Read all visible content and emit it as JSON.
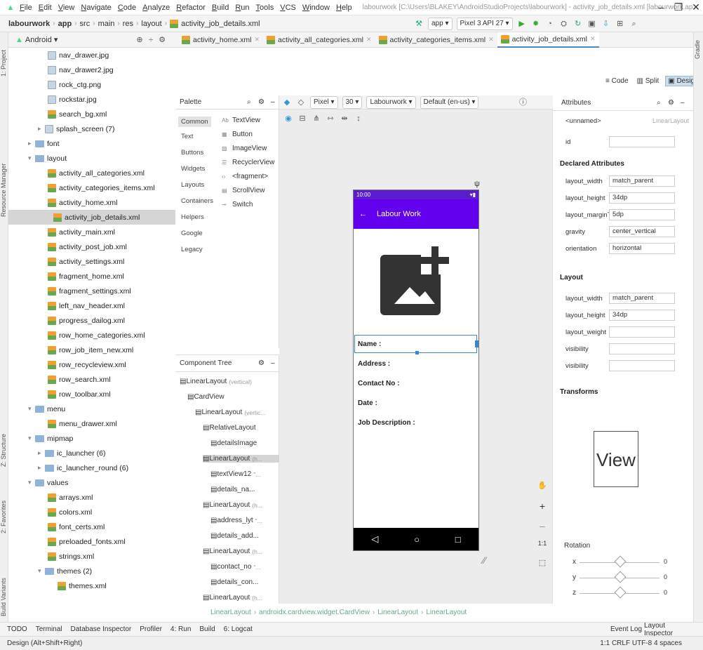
{
  "menu": [
    "File",
    "Edit",
    "View",
    "Navigate",
    "Code",
    "Analyze",
    "Refactor",
    "Build",
    "Run",
    "Tools",
    "VCS",
    "Window",
    "Help"
  ],
  "window_title": "labourwork [C:\\Users\\BLAKEY\\AndroidStudioProjects\\labourwork] - activity_job_details.xml [labourwork.app] - Android Studio",
  "nav": {
    "crumbs": [
      "labourwork",
      "app",
      "src",
      "main",
      "res",
      "layout",
      "activity_job_details.xml"
    ],
    "run_config": "app",
    "device": "Pixel 3 API 27"
  },
  "project_view": "Android",
  "tree": [
    {
      "label": "nav_drawer.jpg",
      "type": "img",
      "indent": 4
    },
    {
      "label": "nav_drawer2.jpg",
      "type": "img",
      "indent": 4
    },
    {
      "label": "rock_ctg.png",
      "type": "img",
      "indent": 4
    },
    {
      "label": "rockstar.jpg",
      "type": "img",
      "indent": 4
    },
    {
      "label": "search_bg.xml",
      "type": "xml",
      "indent": 4
    },
    {
      "label": "splash_screen (7)",
      "type": "img",
      "indent": 3,
      "arrow": "▸"
    },
    {
      "label": "font",
      "type": "fld",
      "indent": 2,
      "arrow": "▸"
    },
    {
      "label": "layout",
      "type": "fld",
      "indent": 2,
      "arrow": "▾"
    },
    {
      "label": "activity_all_categories.xml",
      "type": "xml",
      "indent": 4
    },
    {
      "label": "activity_categories_items.xml",
      "type": "xml",
      "indent": 4
    },
    {
      "label": "activity_home.xml",
      "type": "xml",
      "indent": 4
    },
    {
      "label": "activity_job_details.xml",
      "type": "xml",
      "indent": 4,
      "selected": true
    },
    {
      "label": "activity_main.xml",
      "type": "xml",
      "indent": 4
    },
    {
      "label": "activity_post_job.xml",
      "type": "xml",
      "indent": 4
    },
    {
      "label": "activity_settings.xml",
      "type": "xml",
      "indent": 4
    },
    {
      "label": "fragment_home.xml",
      "type": "xml",
      "indent": 4
    },
    {
      "label": "fragment_settings.xml",
      "type": "xml",
      "indent": 4
    },
    {
      "label": "left_nav_header.xml",
      "type": "xml",
      "indent": 4
    },
    {
      "label": "progress_dailog.xml",
      "type": "xml",
      "indent": 4
    },
    {
      "label": "row_home_categories.xml",
      "type": "xml",
      "indent": 4
    },
    {
      "label": "row_job_item_new.xml",
      "type": "xml",
      "indent": 4
    },
    {
      "label": "row_recycleview.xml",
      "type": "xml",
      "indent": 4
    },
    {
      "label": "row_search.xml",
      "type": "xml",
      "indent": 4
    },
    {
      "label": "row_toolbar.xml",
      "type": "xml",
      "indent": 4
    },
    {
      "label": "menu",
      "type": "fld",
      "indent": 2,
      "arrow": "▾"
    },
    {
      "label": "menu_drawer.xml",
      "type": "xml",
      "indent": 4
    },
    {
      "label": "mipmap",
      "type": "fld",
      "indent": 2,
      "arrow": "▾"
    },
    {
      "label": "ic_launcher (6)",
      "type": "fld",
      "indent": 3,
      "arrow": "▸"
    },
    {
      "label": "ic_launcher_round (6)",
      "type": "fld",
      "indent": 3,
      "arrow": "▸"
    },
    {
      "label": "values",
      "type": "fld",
      "indent": 2,
      "arrow": "▾"
    },
    {
      "label": "arrays.xml",
      "type": "xml",
      "indent": 4
    },
    {
      "label": "colors.xml",
      "type": "xml",
      "indent": 4
    },
    {
      "label": "font_certs.xml",
      "type": "xml",
      "indent": 4
    },
    {
      "label": "preloaded_fonts.xml",
      "type": "xml",
      "indent": 4
    },
    {
      "label": "strings.xml",
      "type": "xml",
      "indent": 4
    },
    {
      "label": "themes (2)",
      "type": "fld",
      "indent": 3,
      "arrow": "▾"
    },
    {
      "label": "themes.xml",
      "type": "xml",
      "indent": 5
    }
  ],
  "editor_tabs": [
    "activity_home.xml",
    "activity_all_categories.xml",
    "activity_categories_items.xml",
    "activity_job_details.xml"
  ],
  "view_modes": [
    "Code",
    "Split",
    "Design"
  ],
  "palette": {
    "title": "Palette",
    "categories": [
      "Common",
      "Text",
      "Buttons",
      "Widgets",
      "Layouts",
      "Containers",
      "Helpers",
      "Google",
      "Legacy"
    ],
    "items": [
      "TextView",
      "Button",
      "ImageView",
      "RecyclerView",
      "<fragment>",
      "ScrollView",
      "Switch"
    ]
  },
  "design_toolbar": {
    "device": "Pixel",
    "api": "30",
    "theme": "Labourwork",
    "locale": "Default (en-us)"
  },
  "phone": {
    "time": "10:00",
    "title": "Labour Work",
    "labels": [
      "Name :",
      "Address :",
      "Contact No :",
      "Date :",
      "Job Description :"
    ]
  },
  "component_tree": {
    "title": "Component Tree",
    "items": [
      {
        "label": "LinearLayout",
        "hint": "(vertical)",
        "indent": 0
      },
      {
        "label": "CardView",
        "hint": "",
        "indent": 1
      },
      {
        "label": "LinearLayout",
        "hint": "(vertic...",
        "indent": 2
      },
      {
        "label": "RelativeLayout",
        "hint": "",
        "indent": 3
      },
      {
        "label": "detailsImage",
        "hint": "",
        "indent": 4
      },
      {
        "label": "LinearLayout",
        "hint": "(h...",
        "indent": 3,
        "selected": true
      },
      {
        "label": "textView12",
        "hint": "\"...",
        "indent": 4
      },
      {
        "label": "details_na...",
        "hint": "",
        "indent": 4
      },
      {
        "label": "LinearLayout",
        "hint": "(h...",
        "indent": 3
      },
      {
        "label": "address_lyt",
        "hint": "\"...",
        "indent": 4
      },
      {
        "label": "details_add...",
        "hint": "",
        "indent": 4
      },
      {
        "label": "LinearLayout",
        "hint": "(h...",
        "indent": 3
      },
      {
        "label": "contact_no",
        "hint": "\"...",
        "indent": 4
      },
      {
        "label": "details_con...",
        "hint": "",
        "indent": 4
      },
      {
        "label": "LinearLayout",
        "hint": "(h...",
        "indent": 3
      }
    ]
  },
  "attributes": {
    "title": "Attributes",
    "element": "<unnamed>",
    "element_type": "LinearLayout",
    "id_label": "id",
    "declared_title": "Declared Attributes",
    "declared": [
      [
        "layout_width",
        "match_parent"
      ],
      [
        "layout_height",
        "34dp"
      ],
      [
        "layout_marginTop",
        "5dp"
      ],
      [
        "gravity",
        "center_vertical"
      ],
      [
        "orientation",
        "horizontal"
      ]
    ],
    "layout_title": "Layout",
    "layout": [
      [
        "layout_width",
        "match_parent"
      ],
      [
        "layout_height",
        "34dp"
      ],
      [
        "layout_weight",
        ""
      ],
      [
        "visibility",
        ""
      ],
      [
        "visibility",
        ""
      ]
    ],
    "transforms_title": "Transforms",
    "view_label": "View",
    "rotation_title": "Rotation",
    "axes": [
      "x",
      "y",
      "z"
    ],
    "rotation_value": "0"
  },
  "design_breadcrumb": [
    "LinearLayout",
    "androidx.cardview.widget.CardView",
    "LinearLayout",
    "LinearLayout"
  ],
  "bottom_tools": [
    "TODO",
    "Terminal",
    "Database Inspector",
    "Profiler",
    "4: Run",
    "Build",
    "6: Logcat"
  ],
  "bottom_right": [
    "Event Log",
    "Layout Inspector"
  ],
  "status": {
    "left": "Design (Alt+Shift+Right)",
    "right": "1:1  CRLF  UTF-8  4 spaces"
  },
  "side_tabs": [
    "1: Project",
    "Resource Manager",
    "Z: Structure",
    "2: Favorites",
    "Build Variants"
  ],
  "gradle_tab": "Gradle"
}
